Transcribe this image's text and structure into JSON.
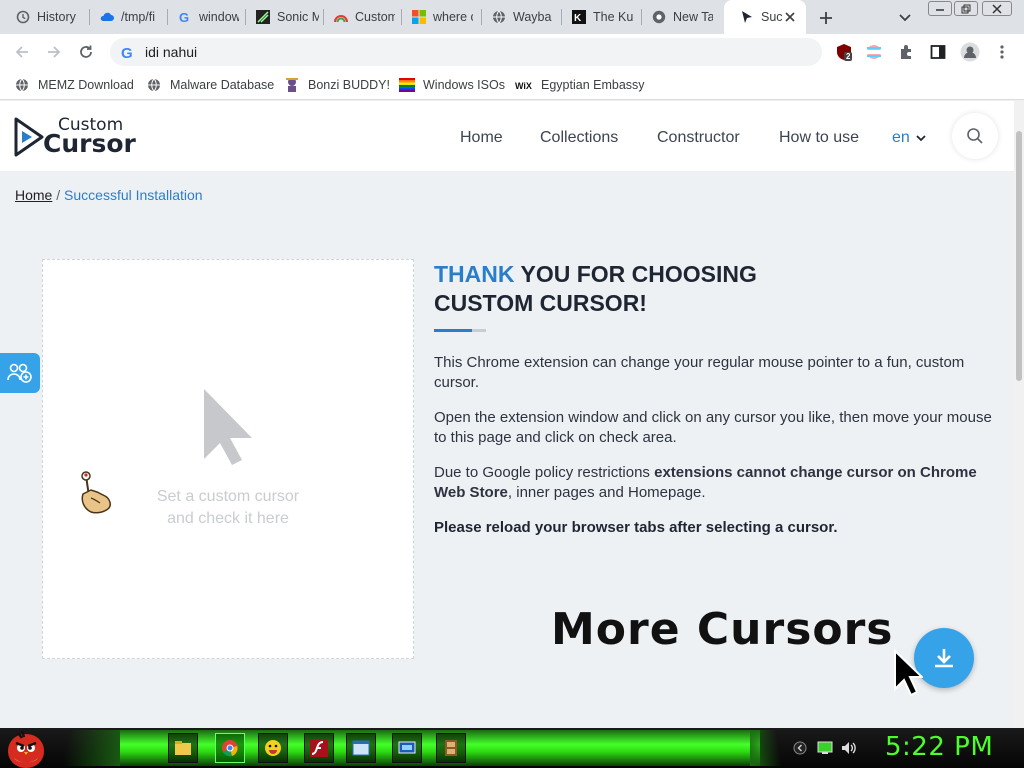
{
  "tabs": [
    {
      "title": "History",
      "icon": "history-icon"
    },
    {
      "title": "/tmp/fi",
      "icon": "cloud-icon"
    },
    {
      "title": "window",
      "icon": "google-icon"
    },
    {
      "title": "Sonic M",
      "icon": "sonic-icon"
    },
    {
      "title": "Custom",
      "icon": "rainbow-icon"
    },
    {
      "title": "where c",
      "icon": "microsoft-icon"
    },
    {
      "title": "Wayba",
      "icon": "globe-icon"
    },
    {
      "title": "The Ku",
      "icon": "ku-icon"
    },
    {
      "title": "New Ta",
      "icon": "chrome-icon"
    },
    {
      "title": "Suc",
      "icon": "cursor-icon"
    }
  ],
  "address_bar": {
    "value": "idi nahui"
  },
  "extensions": {
    "badge_count": "2"
  },
  "bookmarks": [
    {
      "label": "MEMZ Download",
      "icon": "globe-icon"
    },
    {
      "label": "Malware Database",
      "icon": "globe-icon"
    },
    {
      "label": "Bonzi BUDDY!",
      "icon": "bonzi-icon"
    },
    {
      "label": "Windows ISOs",
      "icon": "rainbow-flag-icon"
    },
    {
      "label": "Egyptian Embassy",
      "icon": "wix-icon"
    }
  ],
  "logo": {
    "line1": "Custom",
    "line2": "Cursor"
  },
  "nav": {
    "items": [
      "Home",
      "Collections",
      "Constructor",
      "How to use"
    ],
    "lang": "en"
  },
  "breadcrumb": {
    "home": "Home",
    "separator": "/",
    "current": "Successful Installation"
  },
  "check_area": {
    "line1": "Set a custom cursor",
    "line2": "and check it here"
  },
  "heading": {
    "highlight": "THANK",
    "rest_line1": " YOU FOR CHOOSING",
    "line2": "CUSTOM CURSOR!"
  },
  "paragraphs": {
    "p1": "This Chrome extension can change your regular mouse pointer to a fun, custom cursor.",
    "p2": "Open the extension window and click on any cursor you like, then move your mouse to this page and click on check area.",
    "p3_start": "Due to Google policy restrictions ",
    "p3_bold": "extensions cannot change cursor on Chrome Web Store",
    "p3_end": ", inner pages and Homepage.",
    "p4": "Please reload your browser tabs after selecting a cursor."
  },
  "more_cursors": "More Cursors",
  "taskbar": {
    "clock": "5:22 PM"
  },
  "colors": {
    "accent": "#2a7ec9",
    "fab": "#36a3e8",
    "taskbar_green": "#2ddc12",
    "clock": "#4dff2a"
  }
}
